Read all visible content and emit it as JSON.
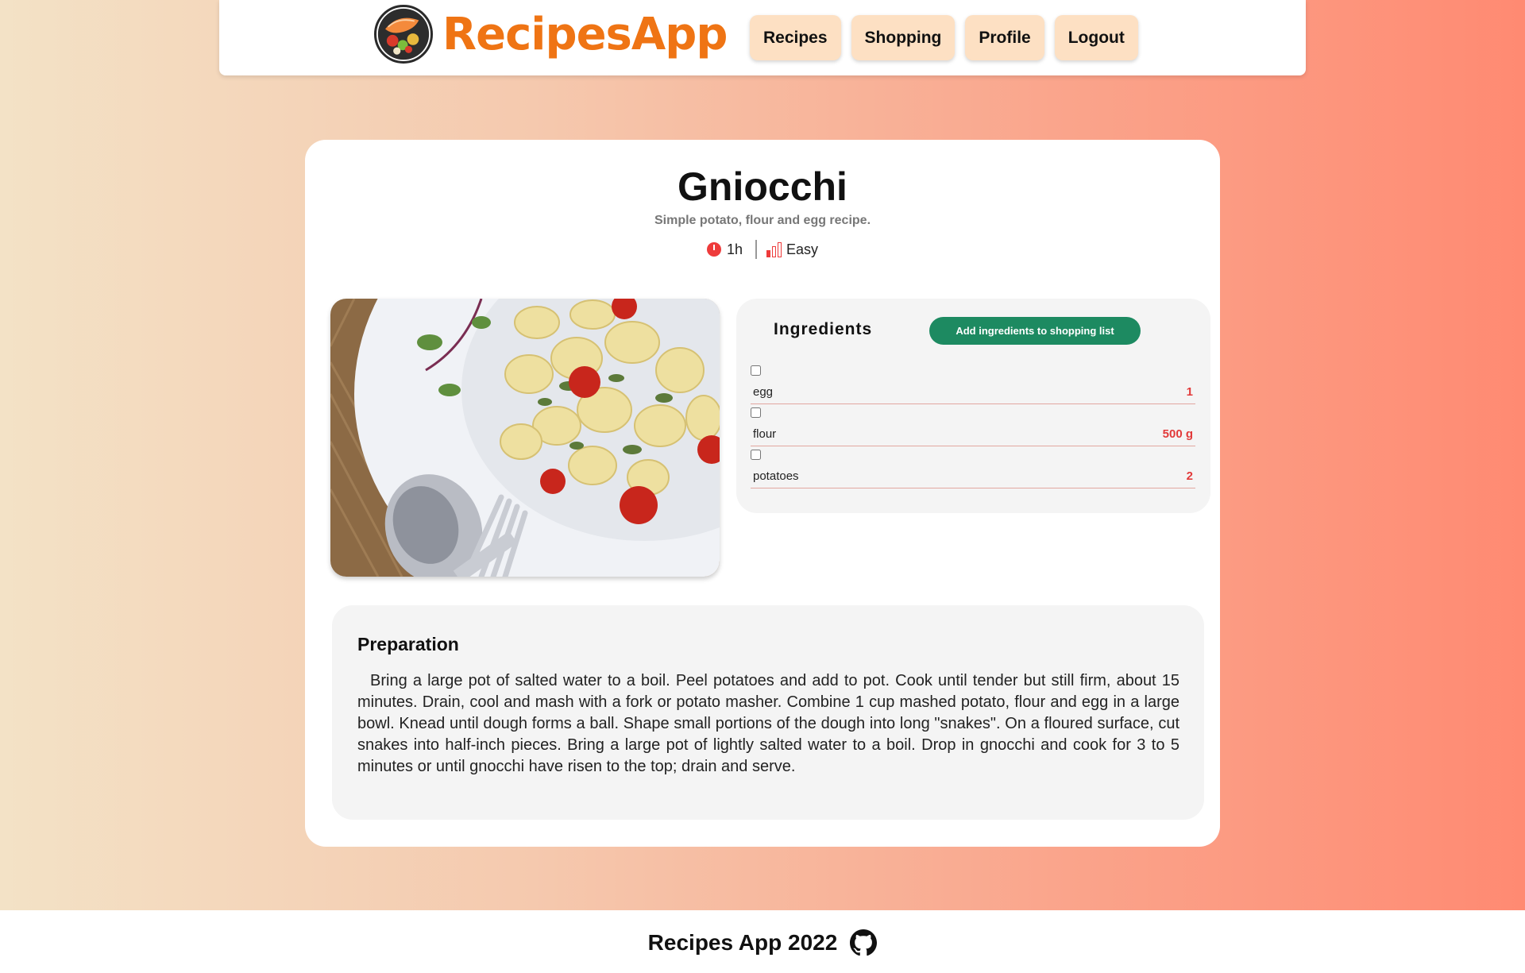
{
  "header": {
    "brand": "RecipesApp",
    "nav": [
      "Recipes",
      "Shopping",
      "Profile",
      "Logout"
    ]
  },
  "recipe": {
    "title": "Gniocchi",
    "subtitle": "Simple potato, flour and egg recipe.",
    "time": "1h",
    "difficulty": "Easy",
    "image_icon": "gnocchi-plate-photo"
  },
  "ingredients": {
    "title": "Ingredients",
    "add_button": "Add ingredients to shopping list",
    "items": [
      {
        "name": "egg",
        "qty": "1"
      },
      {
        "name": "flour",
        "qty": "500 g"
      },
      {
        "name": "potatoes",
        "qty": "2"
      }
    ]
  },
  "preparation": {
    "title": "Preparation",
    "text": "Bring a large pot of salted water to a boil. Peel potatoes and add to pot. Cook until tender but still firm, about 15 minutes. Drain, cool and mash with a fork or potato masher. Combine 1 cup mashed potato, flour and egg in a large bowl. Knead until dough forms a ball. Shape small portions of the dough into long \"snakes\". On a floured surface, cut snakes into half-inch pieces. Bring a large pot of lightly salted water to a boil. Drop in gnocchi and cook for 3 to 5 minutes or until gnocchi have risen to the top; drain and serve."
  },
  "footer": {
    "text": "Recipes App 2022",
    "icon": "github-icon"
  },
  "colors": {
    "brand": "#ef7414",
    "nav_button": "#fde0c3",
    "accent_green": "#1d8a61",
    "quantity_red": "#e23a3a"
  }
}
